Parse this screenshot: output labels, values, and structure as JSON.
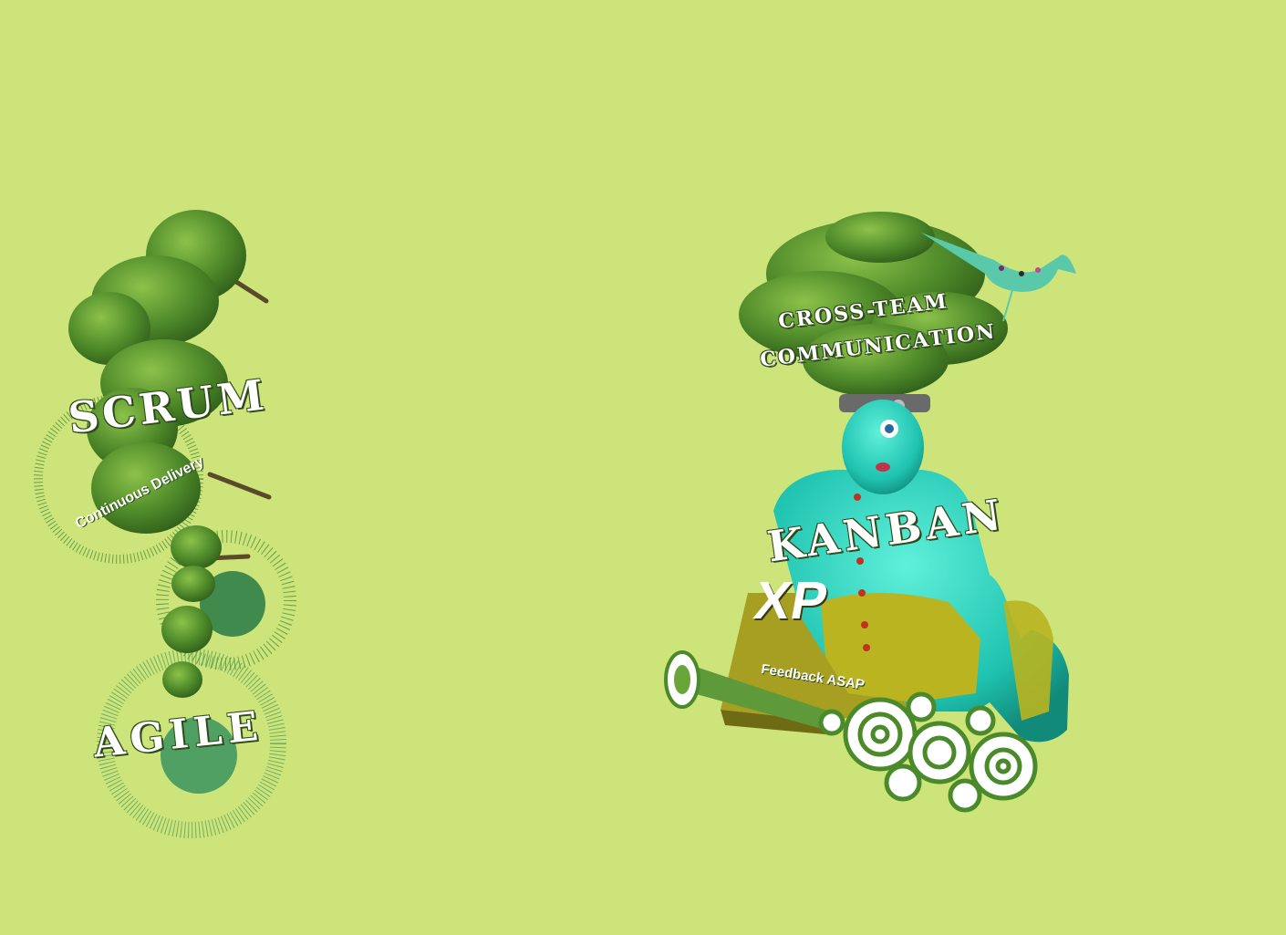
{
  "page": {
    "background_color": "#cde47a"
  },
  "labels": {
    "scrum": "SCRUM",
    "continuous_delivery": "Continuous Delivery",
    "agile": "AGILE",
    "cross_team": "CROSS-TEAM",
    "communication": "COMMUNICATION",
    "kanban": "KANBAN",
    "xp": "XP",
    "feedback": "Feedback ASAP"
  },
  "colors": {
    "tree_dark": "#3f7a22",
    "tree_light": "#6aa53a",
    "ring_green": "#4e9a5c",
    "figure_teal": "#2ad6c2",
    "dress_olive": "#b8b422",
    "swirl_green": "#4a8a2a"
  }
}
